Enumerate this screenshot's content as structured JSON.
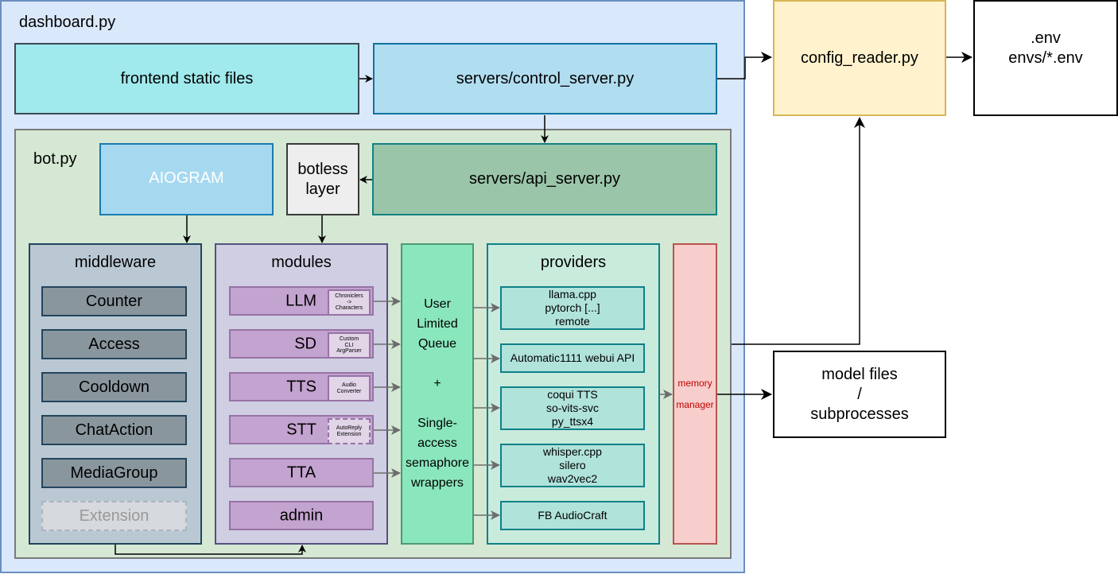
{
  "diagram": {
    "dashboard": {
      "title": "dashboard.py",
      "frontend": "frontend static files",
      "control_server": "servers/control_server.py"
    },
    "config_reader": "config_reader.py",
    "env_files": ".env\nenvs/*.env",
    "model_files": "model files\n/\nsubprocesses",
    "bot": {
      "title": "bot.py",
      "aiogram": "AIOGRAM",
      "botless": "botless\nlayer",
      "api_server": "servers/api_server.py",
      "middleware": {
        "title": "middleware",
        "items": [
          "Counter",
          "Access",
          "Cooldown",
          "ChatAction",
          "MediaGroup",
          "Extension"
        ]
      },
      "modules": {
        "title": "modules",
        "items": [
          {
            "name": "LLM",
            "sub": "Chroniclers\n->\nCharacters"
          },
          {
            "name": "SD",
            "sub": "Custom\nCLI\nArgParser"
          },
          {
            "name": "TTS",
            "sub": "Audio\nConverter"
          },
          {
            "name": "STT",
            "sub": "AutoReply\nExtension"
          },
          {
            "name": "TTA"
          },
          {
            "name": "admin"
          }
        ]
      },
      "queue": "User\nLimited\nQueue\n\n+\n\nSingle-\naccess\nsemaphore\nwrappers",
      "providers": {
        "title": "providers",
        "items": [
          "llama.cpp\npytorch [...]\nremote",
          "Automatic1111 webui API",
          "coqui TTS\nso-vits-svc\npy_ttsx4",
          "whisper.cpp\nsilero\nwav2vec2",
          "FB AudioCraft"
        ]
      },
      "memory_manager": "memory\nmanager"
    }
  },
  "colors": {
    "dashboard_fill": "#dae8fc",
    "bot_fill": "#d5e8d4",
    "config_fill": "#fff2cc",
    "memory_text": "#c00000"
  }
}
